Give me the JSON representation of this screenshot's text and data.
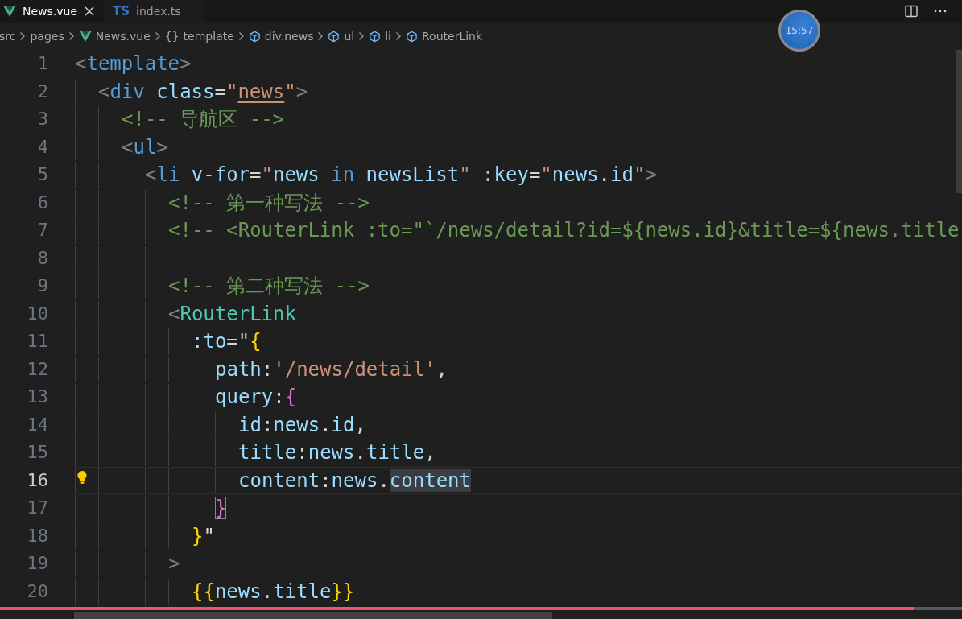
{
  "tabs": [
    {
      "label": "News.vue",
      "kind": "vue",
      "selected": true
    },
    {
      "label": "index.ts",
      "kind": "ts",
      "badge": "TS",
      "selected": false
    }
  ],
  "breadcrumbs": [
    {
      "label": "src",
      "kind": "folder"
    },
    {
      "label": "pages",
      "kind": "folder"
    },
    {
      "label": "News.vue",
      "kind": "vue"
    },
    {
      "label": "{}",
      "kind": "braces"
    },
    {
      "label": "template",
      "kind": "plain"
    },
    {
      "label": "div.news",
      "kind": "element"
    },
    {
      "label": "ul",
      "kind": "element"
    },
    {
      "label": "li",
      "kind": "element"
    },
    {
      "label": "RouterLink",
      "kind": "element"
    }
  ],
  "clock_overlay": {
    "time": "15:57"
  },
  "lines": [
    {
      "number": "1",
      "active": false,
      "lightbulb": false,
      "tokens": [
        {
          "text": "<",
          "kind": "punct"
        },
        {
          "text": "template",
          "kind": "tag"
        },
        {
          "text": ">",
          "kind": "punct"
        }
      ],
      "children": [
        {
          "number": "2",
          "active": false,
          "lightbulb": false,
          "tokens": [
            {
              "text": "<",
              "kind": "punct"
            },
            {
              "text": "div",
              "kind": "tag"
            },
            {
              "text": " class",
              "kind": "attr"
            },
            {
              "text": "=",
              "kind": "text"
            },
            {
              "text": "\"",
              "kind": "string"
            },
            {
              "text": "news",
              "kind": "string_warn"
            },
            {
              "text": "\"",
              "kind": "string"
            },
            {
              "text": ">",
              "kind": "punct"
            }
          ],
          "children": [
            {
              "number": "3",
              "active": false,
              "lightbulb": false,
              "tokens": [
                {
                  "text": "<!-- 导航区 -->",
                  "kind": "comment"
                }
              ]
            },
            {
              "number": "4",
              "active": false,
              "lightbulb": false,
              "tokens": [
                {
                  "text": "<",
                  "kind": "punct"
                },
                {
                  "text": "ul",
                  "kind": "tag"
                },
                {
                  "text": ">",
                  "kind": "punct"
                }
              ],
              "children": [
                {
                  "number": "5",
                  "active": false,
                  "lightbulb": false,
                  "tokens": [
                    {
                      "text": "<",
                      "kind": "punct"
                    },
                    {
                      "text": "li",
                      "kind": "tag"
                    },
                    {
                      "text": " v-for",
                      "kind": "attr"
                    },
                    {
                      "text": "=",
                      "kind": "text"
                    },
                    {
                      "text": "\"",
                      "kind": "string"
                    },
                    {
                      "text": "news",
                      "kind": "var"
                    },
                    {
                      "text": " in",
                      "kind": "keyword"
                    },
                    {
                      "text": " newsList",
                      "kind": "var"
                    },
                    {
                      "text": "\"",
                      "kind": "string"
                    },
                    {
                      "text": " :key",
                      "kind": "attr"
                    },
                    {
                      "text": "=",
                      "kind": "text"
                    },
                    {
                      "text": "\"",
                      "kind": "string"
                    },
                    {
                      "text": "news",
                      "kind": "var"
                    },
                    {
                      "text": ".",
                      "kind": "text"
                    },
                    {
                      "text": "id",
                      "kind": "var"
                    },
                    {
                      "text": "\"",
                      "kind": "string"
                    },
                    {
                      "text": ">",
                      "kind": "punct"
                    }
                  ],
                  "children": [
                    {
                      "number": "6",
                      "active": false,
                      "lightbulb": false,
                      "tokens": [
                        {
                          "text": "<!-- 第一种写法 -->",
                          "kind": "comment"
                        }
                      ]
                    },
                    {
                      "number": "7",
                      "active": false,
                      "lightbulb": false,
                      "tokens": [
                        {
                          "text": "<!-- <RouterLink :to=\"`/news/detail?id=${news.id}&title=${news.title",
                          "kind": "comment"
                        }
                      ]
                    },
                    {
                      "number": "8",
                      "active": false,
                      "lightbulb": false
                    },
                    {
                      "number": "9",
                      "active": false,
                      "lightbulb": false,
                      "tokens": [
                        {
                          "text": "<!-- 第二种写法 -->",
                          "kind": "comment"
                        }
                      ]
                    },
                    {
                      "number": "10",
                      "active": false,
                      "lightbulb": false,
                      "tokens": [
                        {
                          "text": "<",
                          "kind": "punct"
                        },
                        {
                          "text": "RouterLink",
                          "kind": "component"
                        }
                      ],
                      "children": [
                        {
                          "number": "11",
                          "active": false,
                          "lightbulb": false,
                          "tokens": [
                            {
                              "text": ":to",
                              "kind": "attr"
                            },
                            {
                              "text": "=\"",
                              "kind": "text"
                            },
                            {
                              "text": "{",
                              "kind": "bracket1"
                            }
                          ],
                          "children": [
                            {
                              "number": "12",
                              "active": false,
                              "lightbulb": false,
                              "tokens": [
                                {
                                  "text": "path",
                                  "kind": "key"
                                },
                                {
                                  "text": ":",
                                  "kind": "text"
                                },
                                {
                                  "text": "'/news/detail'",
                                  "kind": "string"
                                },
                                {
                                  "text": ",",
                                  "kind": "text"
                                }
                              ]
                            },
                            {
                              "number": "13",
                              "active": false,
                              "lightbulb": false,
                              "tokens": [
                                {
                                  "text": "query",
                                  "kind": "key"
                                },
                                {
                                  "text": ":",
                                  "kind": "text"
                                },
                                {
                                  "text": "{",
                                  "kind": "bracket2"
                                }
                              ],
                              "children": [
                                {
                                  "number": "14",
                                  "active": false,
                                  "lightbulb": false,
                                  "tokens": [
                                    {
                                      "text": "id",
                                      "kind": "key"
                                    },
                                    {
                                      "text": ":",
                                      "kind": "text"
                                    },
                                    {
                                      "text": "news",
                                      "kind": "var"
                                    },
                                    {
                                      "text": ".",
                                      "kind": "text"
                                    },
                                    {
                                      "text": "id",
                                      "kind": "var"
                                    },
                                    {
                                      "text": ",",
                                      "kind": "text"
                                    }
                                  ]
                                },
                                {
                                  "number": "15",
                                  "active": false,
                                  "lightbulb": false,
                                  "tokens": [
                                    {
                                      "text": "title",
                                      "kind": "key"
                                    },
                                    {
                                      "text": ":",
                                      "kind": "text"
                                    },
                                    {
                                      "text": "news",
                                      "kind": "var"
                                    },
                                    {
                                      "text": ".",
                                      "kind": "text"
                                    },
                                    {
                                      "text": "title",
                                      "kind": "var"
                                    },
                                    {
                                      "text": ",",
                                      "kind": "text"
                                    }
                                  ]
                                },
                                {
                                  "number": "16",
                                  "active": true,
                                  "lightbulb": true,
                                  "tokens": [
                                    {
                                      "text": "content",
                                      "kind": "key"
                                    },
                                    {
                                      "text": ":",
                                      "kind": "text"
                                    },
                                    {
                                      "text": "news",
                                      "kind": "var"
                                    },
                                    {
                                      "text": ".",
                                      "kind": "text"
                                    },
                                    {
                                      "text": "content",
                                      "kind": "var_highlighted"
                                    }
                                  ]
                                }
                              ]
                            },
                            {
                              "number": "17",
                              "active": false,
                              "lightbulb": false,
                              "tokens": [
                                {
                                  "text": "}",
                                  "kind": "bracket2_matched"
                                }
                              ]
                            }
                          ]
                        },
                        {
                          "number": "18",
                          "active": false,
                          "lightbulb": false,
                          "tokens": [
                            {
                              "text": "}",
                              "kind": "bracket1"
                            },
                            {
                              "text": "\"",
                              "kind": "text"
                            }
                          ]
                        }
                      ]
                    },
                    {
                      "number": "19",
                      "active": false,
                      "lightbulb": false,
                      "tokens": [
                        {
                          "text": ">",
                          "kind": "punct"
                        }
                      ],
                      "children": [
                        {
                          "number": "20",
                          "active": false,
                          "lightbulb": false,
                          "tokens": [
                            {
                              "text": "{{",
                              "kind": "bracket1"
                            },
                            {
                              "text": "news",
                              "kind": "var"
                            },
                            {
                              "text": ".",
                              "kind": "text"
                            },
                            {
                              "text": "title",
                              "kind": "var"
                            },
                            {
                              "text": "}}",
                              "kind": "bracket1"
                            }
                          ]
                        }
                      ]
                    }
                  ]
                }
              ]
            }
          ]
        }
      ]
    }
  ],
  "video_progress": {
    "level": 0.95
  }
}
